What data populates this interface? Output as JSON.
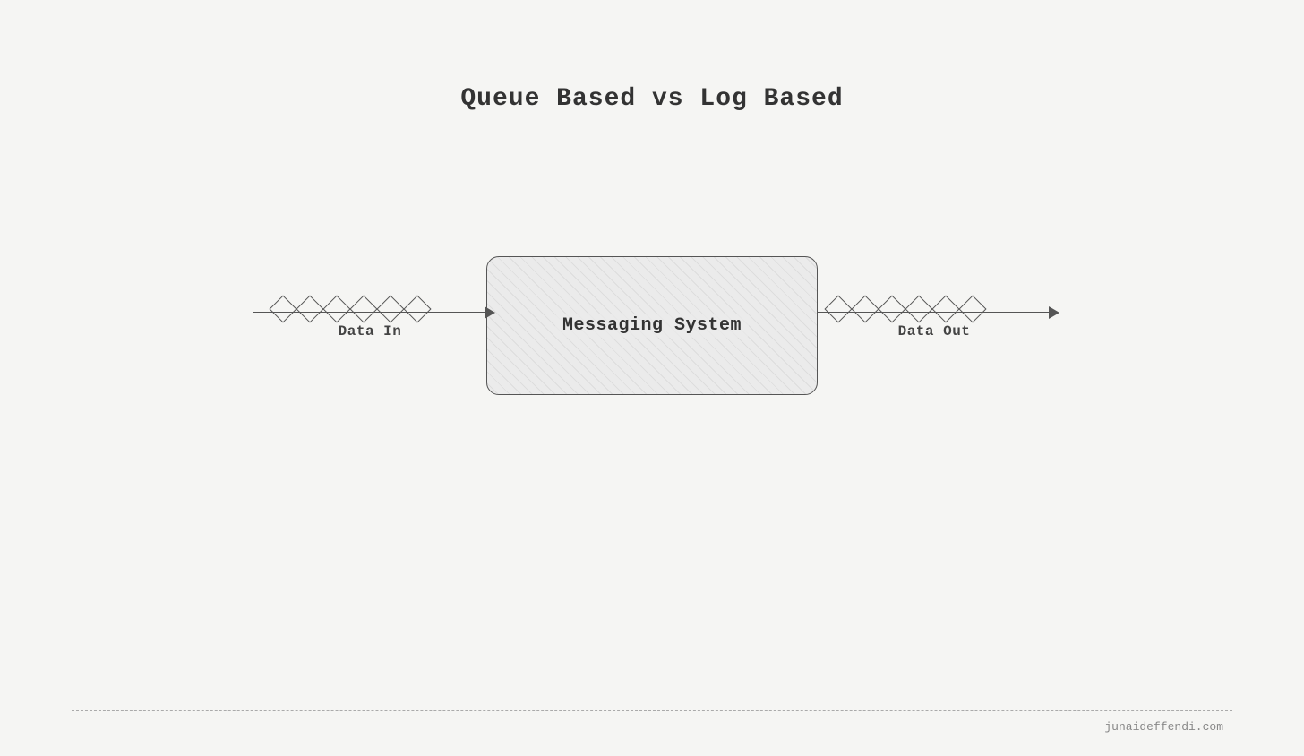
{
  "title": "Queue Based vs Log Based",
  "diagram": {
    "data_in_label": "Data In",
    "data_out_label": "Data Out",
    "messaging_box_label": "Messaging System",
    "diamond_count_in": 6,
    "diamond_count_out": 6
  },
  "footer": {
    "url": "junaideffendi.com"
  }
}
